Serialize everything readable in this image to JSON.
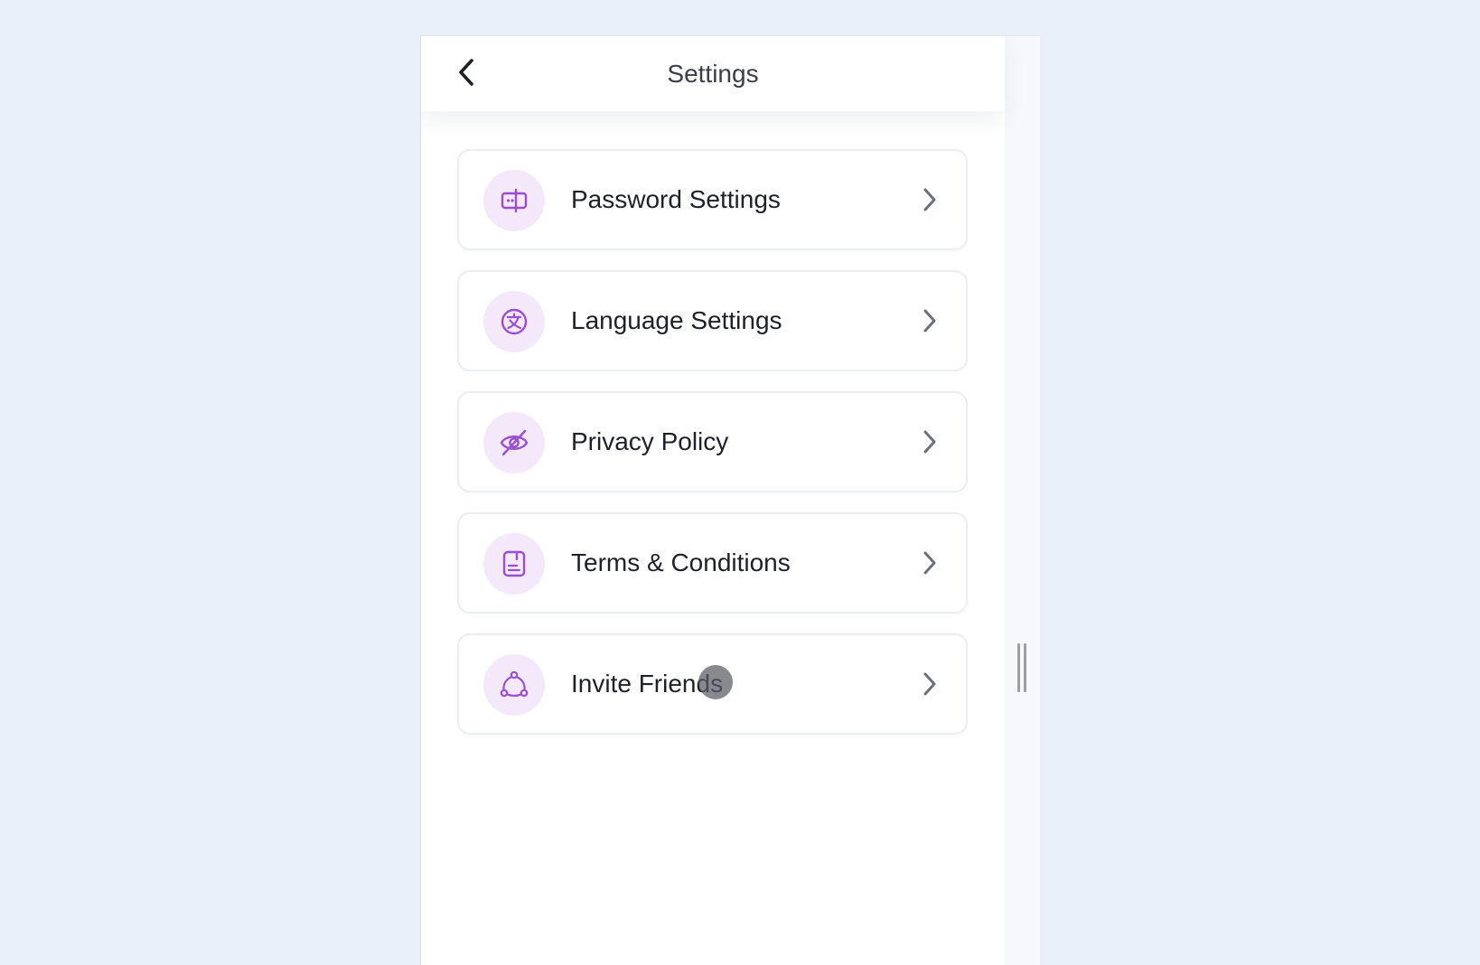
{
  "header": {
    "title": "Settings",
    "back_icon": "chevron-left-icon"
  },
  "settings_items": [
    {
      "label": "Password Settings",
      "icon": "password-lock-icon"
    },
    {
      "label": "Language Settings",
      "icon": "language-translate-icon"
    },
    {
      "label": "Privacy Policy",
      "icon": "eye-off-icon"
    },
    {
      "label": "Terms & Conditions",
      "icon": "document-icon"
    },
    {
      "label": "Invite Friends",
      "icon": "share-network-icon"
    }
  ],
  "colors": {
    "accent": "#9b4fd0",
    "icon_background": "#f3e9fb",
    "page_background": "#eaf0fa",
    "chevron": "#6b6f78"
  }
}
